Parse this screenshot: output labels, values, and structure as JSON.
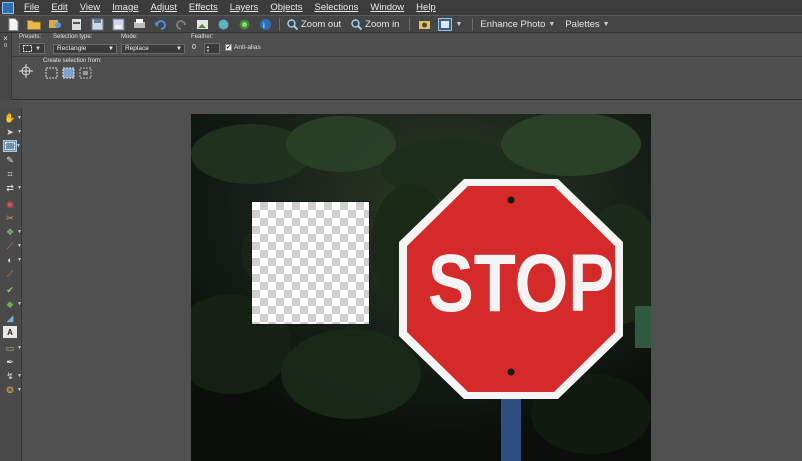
{
  "menu": {
    "items": [
      {
        "label": "File",
        "u": "F"
      },
      {
        "label": "Edit",
        "u": "E"
      },
      {
        "label": "View",
        "u": "V"
      },
      {
        "label": "Image",
        "u": "I"
      },
      {
        "label": "Adjust",
        "u": "A"
      },
      {
        "label": "Effects",
        "u": "c"
      },
      {
        "label": "Layers",
        "u": "L"
      },
      {
        "label": "Objects",
        "u": "O"
      },
      {
        "label": "Selections",
        "u": "S"
      },
      {
        "label": "Window",
        "u": "W"
      },
      {
        "label": "Help",
        "u": "H"
      }
    ]
  },
  "toolbar": {
    "zoom_out_label": "Zoom out",
    "zoom_in_label": "Zoom in",
    "enhance_photo_label": "Enhance Photo",
    "palettes_label": "Palettes"
  },
  "tool_options": {
    "presets_label": "Presets:",
    "selection_type_label": "Selection type:",
    "selection_type_value": "Rectangle",
    "mode_label": "Mode:",
    "mode_value": "Replace",
    "feather_label": "Feather:",
    "feather_value": "0",
    "antialias_label": "Anti-alias",
    "antialias_checked": true,
    "create_selection_label": "Create selection from:"
  },
  "canvas": {
    "sign_text": "STOP",
    "colors": {
      "sign_red": "#d42a2a",
      "sign_white": "#f4f4f4",
      "background": "#505050",
      "foliage_dark": "#0f120c"
    }
  }
}
